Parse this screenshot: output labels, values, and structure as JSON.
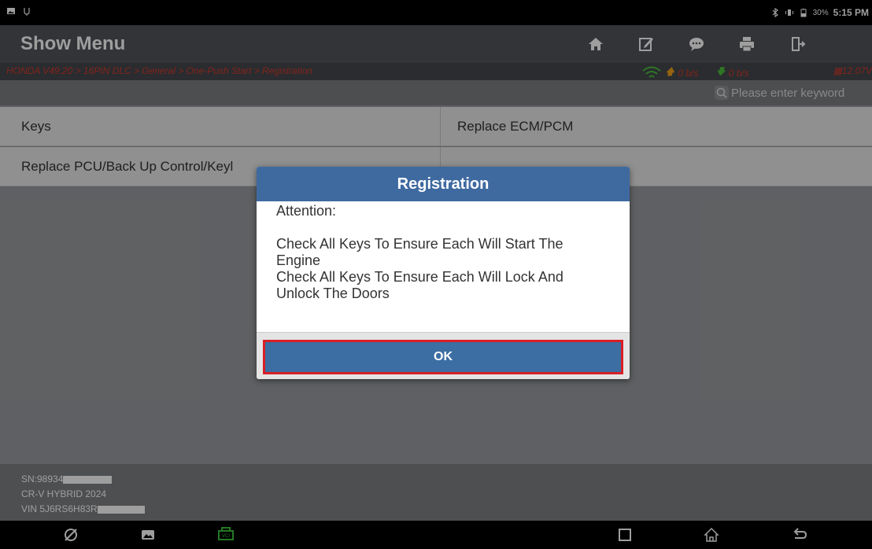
{
  "status_bar": {
    "battery_percent": "30%",
    "time": "5:15 PM",
    "icons": [
      "gallery-icon",
      "usb-icon",
      "bluetooth-icon",
      "vibrate-icon",
      "battery-icon"
    ]
  },
  "header": {
    "title": "Show Menu",
    "tools": [
      "home-icon",
      "edit-icon",
      "message-icon",
      "print-icon",
      "exit-icon"
    ]
  },
  "breadcrumb": {
    "path": "HONDA V49.20 > 16PIN DLC > General > One-Push Start > Registration",
    "upload_rate": "0 b/s",
    "download_rate": "0 b/s",
    "voltage": "12.07V"
  },
  "search": {
    "placeholder": "Please enter keyword"
  },
  "menu": {
    "rows": [
      {
        "left": "Keys",
        "right": "Replace ECM/PCM"
      },
      {
        "left": "Replace PCU/Back Up Control/Keyl",
        "right": ""
      }
    ]
  },
  "footer": {
    "sn": "SN:98934",
    "model": "CR-V HYBRID 2024",
    "vin": "VIN 5J6RS6H83R"
  },
  "navbar": {
    "icons": [
      "browser-icon",
      "gallery-icon",
      "vci-icon",
      "recents-icon",
      "home-icon",
      "back-icon"
    ]
  },
  "dialog": {
    "title": "Registration",
    "attention": "Attention:",
    "line1": "Check All Keys To Ensure Each Will Start The Engine",
    "line2": "Check All Keys To Ensure Each Will Lock And Unlock The Doors",
    "ok_label": "OK"
  },
  "colors": {
    "header_bg": "#52555b",
    "dialog_title_bg": "#3f6aa0",
    "ok_button_bg": "#3d6ea3",
    "ok_button_border": "#d81f26",
    "crumb_text": "#d33a2a"
  }
}
